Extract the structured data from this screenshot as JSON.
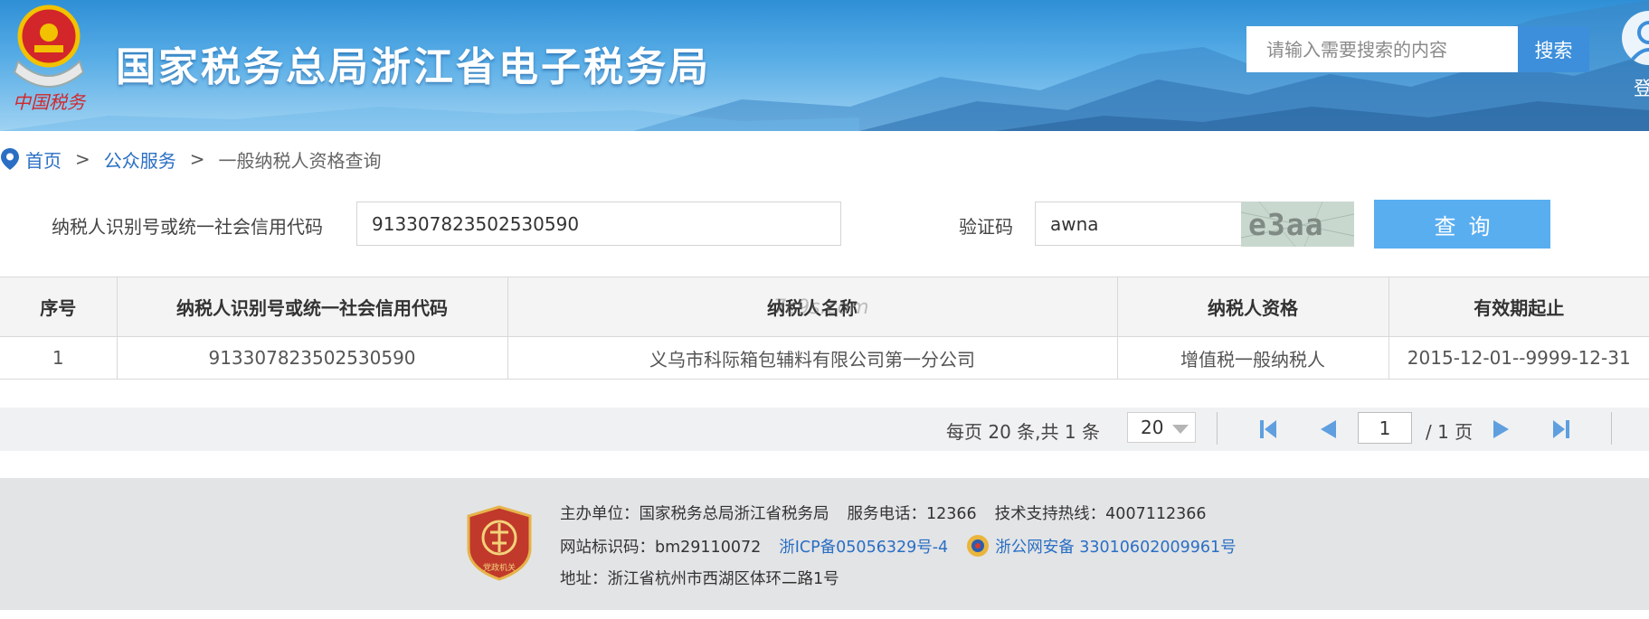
{
  "header": {
    "site_title": "国家税务总局浙江省电子税务局",
    "emblem_caption": "中国税务",
    "search_placeholder": "请输入需要搜索的内容",
    "search_button": "搜索",
    "login_label": "登"
  },
  "breadcrumb": {
    "items": [
      "首页",
      "公众服务",
      "一般纳税人资格查询"
    ],
    "separator": ">"
  },
  "form": {
    "taxpayer_id_label": "纳税人识别号或统一社会信用代码",
    "taxpayer_id_value": "913307823502530590",
    "captcha_label": "验证码",
    "captcha_value": "awna",
    "captcha_image_text": "e3aa",
    "query_button": "查询"
  },
  "table": {
    "headers": [
      "序号",
      "纳税人识别号或统一社会信用代码",
      "纳税人名称",
      "纳税人资格",
      "有效期起止"
    ],
    "rows": [
      [
        "1",
        "913307823502530590",
        "义乌市科际箱包辅料有限公司第一分公司",
        "增值税一般纳税人",
        "2015-12-01--9999-12-31"
      ]
    ],
    "watermark": "7c9s.com"
  },
  "pagination": {
    "summary": "每页 20 条,共 1 条",
    "page_size": "20",
    "current_page": "1",
    "total_pages_text": "/ 1 页"
  },
  "footer": {
    "badge_text": "党政机关",
    "organizer": "主办单位：国家税务总局浙江省税务局",
    "service_phone": "服务电话：12366",
    "tech_hotline": "技术支持热线：4007112366",
    "site_id": "网站标识码：bm29110072",
    "icp": "浙ICP备05056329号-4",
    "police_record": "浙公网安备 33010602009961号",
    "address": "地址：浙江省杭州市西湖区体环二路1号"
  },
  "colors": {
    "link_blue": "#2a6fc4",
    "query_button": "#59aef0",
    "search_button": "#3d8fdb",
    "header_top": "#2f8fd6"
  }
}
